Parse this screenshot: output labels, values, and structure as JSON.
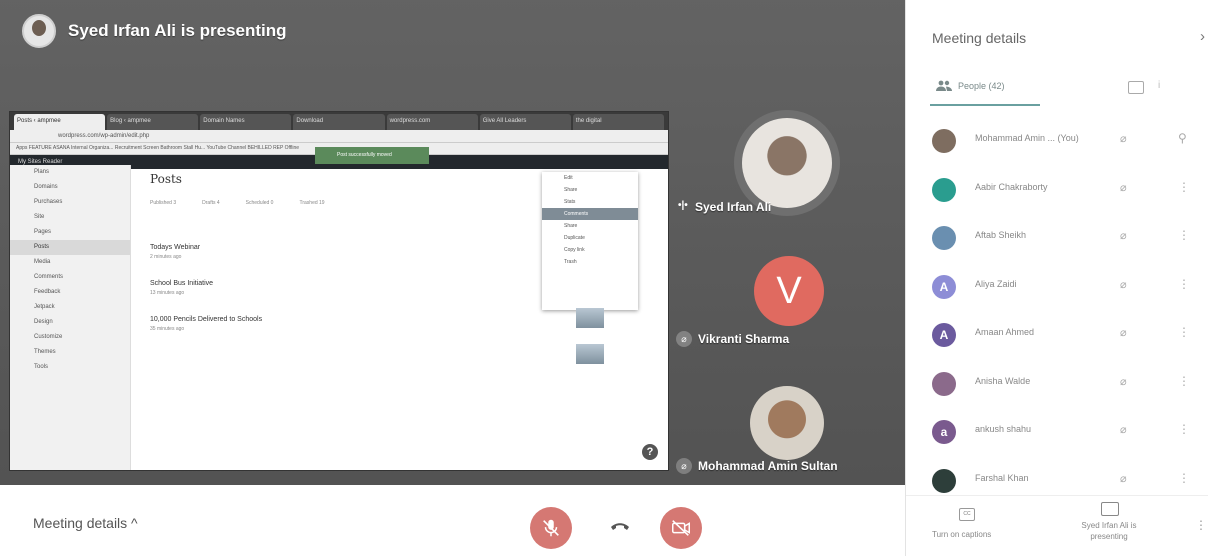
{
  "presenter": {
    "title": "Syed Irfan Ali is presenting"
  },
  "shared_screen": {
    "browser_tabs": [
      "Posts ‹ ampmee",
      "Blog ‹ ampmee",
      "Domain Names",
      "Download",
      "wordpress.com",
      "Give All Leaders",
      "the digital"
    ],
    "url": "wordpress.com/wp-admin/edit.php",
    "bookmarks": "Apps  FEATURE  ASANA  Internal Organiza...  Recruitment  Screen  Bathroom Stall Hu...  YouTube Channel  BEHILLED  REP Offline",
    "admin_bar": "My Sites    Reader",
    "sidebar_items": [
      "Plans",
      "Domains",
      "Purchases",
      "Site",
      "Pages",
      "Posts",
      "Media",
      "Comments",
      "Feedback",
      "Jetpack",
      "Design",
      "Customize",
      "Themes",
      "Tools"
    ],
    "page_title": "Posts",
    "filters": [
      "Published 3",
      "Drafts 4",
      "Scheduled 0",
      "Trashed 19"
    ],
    "notice": "Post successfully moved",
    "posts": [
      {
        "title": "Todays Webinar",
        "meta": "2 minutes ago"
      },
      {
        "title": "School Bus Initiative",
        "meta": "13 minutes ago"
      },
      {
        "title": "10,000 Pencils Delivered to Schools",
        "meta": "35 minutes ago"
      }
    ],
    "menu_items": [
      "Edit",
      "Share",
      "Stats",
      "Comments",
      "Share",
      "Duplicate",
      "Copy link",
      "Trash"
    ],
    "help_icon": "?"
  },
  "tiles": [
    {
      "name": "Syed Irfan Ali",
      "speaking_icon": "•|•"
    },
    {
      "name": "Vikranti Sharma",
      "initial": "V",
      "color": "#e06a60"
    },
    {
      "name": "Mohammad Amin Sultan"
    }
  ],
  "bottombar": {
    "meeting_details_label": "Meeting details  ^",
    "control_color": "#d57873"
  },
  "panel": {
    "title": "Meeting details",
    "close_icon": "›",
    "people_tab": "People (42)",
    "more_tab": "i",
    "people": [
      {
        "name": "Mohammad Amin ...",
        "suffix": "(You)",
        "avatar_color": "#7e6d60",
        "initial": ""
      },
      {
        "name": "Aabir Chakraborty",
        "avatar_color": "#2a9d8f",
        "initial": ""
      },
      {
        "name": "Aftab Sheikh",
        "avatar_color": "#6a8fb0",
        "initial": ""
      },
      {
        "name": "Aliya Zaidi",
        "avatar_color": "#8d8dd6",
        "initial": "A"
      },
      {
        "name": "Amaan Ahmed",
        "avatar_color": "#6b5a9e",
        "initial": "A"
      },
      {
        "name": "Anisha Walde",
        "avatar_color": "#8b6a8b",
        "initial": ""
      },
      {
        "name": "ankush shahu",
        "avatar_color": "#7a5a8e",
        "initial": "a"
      },
      {
        "name": "Farshal Khan",
        "avatar_color": "#2d3e3a",
        "initial": ""
      }
    ],
    "mic_icon": "⌀",
    "more_icon": "⋮",
    "footer": {
      "captions_label": "Turn on captions",
      "present_label": "Syed Irfan Ali is presenting",
      "cc_icon": "CC",
      "more": "⋮"
    }
  }
}
